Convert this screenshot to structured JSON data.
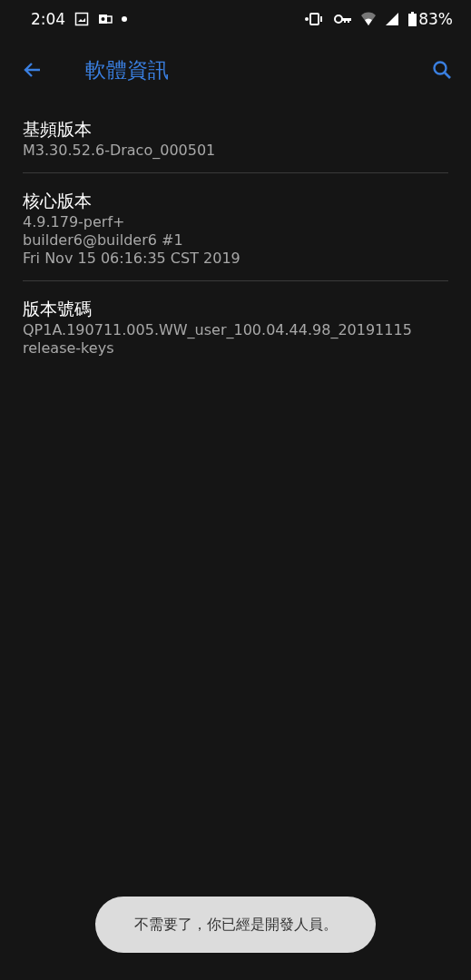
{
  "status_bar": {
    "time": "2:04",
    "battery": "83%"
  },
  "app_bar": {
    "title": "軟體資訊"
  },
  "items": [
    {
      "title": "基頻版本",
      "lines": [
        "M3.30.52.6-Draco_000501"
      ]
    },
    {
      "title": "核心版本",
      "lines": [
        "4.9.179-perf+",
        "builder6@builder6 #1",
        "Fri Nov 15 06:16:35 CST 2019"
      ]
    },
    {
      "title": "版本號碼",
      "lines": [
        "QP1A.190711.005.WW_user_100.04.44.98_20191115",
        "release-keys"
      ]
    }
  ],
  "toast": {
    "text": "不需要了，你已經是開發人員。"
  }
}
